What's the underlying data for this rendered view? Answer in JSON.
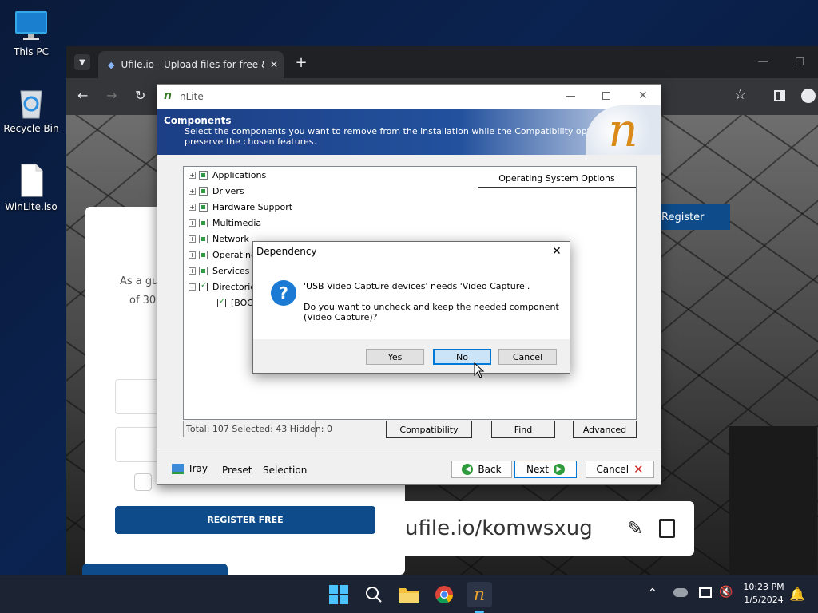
{
  "desktop": {
    "icons": [
      {
        "label": "This PC"
      },
      {
        "label": "Recycle Bin"
      },
      {
        "label": "WinLite.iso"
      }
    ]
  },
  "browser": {
    "tab_title": "Ufile.io - Upload files for free &",
    "tab_close": "✕",
    "new_tab": "+",
    "page": {
      "register_top": "Register",
      "text_line1": "As a gu",
      "text_line2": "of 30",
      "register_free": "REGISTER FREE",
      "link": "ufile.io/komwsxug"
    }
  },
  "nlite": {
    "title": "nLite",
    "header_title": "Components",
    "header_desc1": "Select the components you want to remove from the installation while the Compatibility options",
    "header_desc2": "preserve the chosen features.",
    "tree": [
      {
        "label": "Applications",
        "expander": "+"
      },
      {
        "label": "Drivers",
        "expander": "+"
      },
      {
        "label": "Hardware Support",
        "expander": "+"
      },
      {
        "label": "Multimedia",
        "expander": "+"
      },
      {
        "label": "Network",
        "expander": "+"
      },
      {
        "label": "Operating",
        "expander": "+"
      },
      {
        "label": "Services",
        "expander": "+"
      },
      {
        "label": "Directorie",
        "expander": "-"
      },
      {
        "label": "[BOO"
      }
    ],
    "options_header": "Operating System Options",
    "status": "Total: 107 Selected: 43 Hidden: 0",
    "buttons": {
      "compatibility": "Compatibility",
      "find": "Find",
      "advanced": "Advanced"
    },
    "footer": {
      "tray": "Tray",
      "preset": "Preset",
      "selection": "Selection",
      "back": "Back",
      "next": "Next",
      "cancel": "Cancel"
    }
  },
  "dialog": {
    "title": "Dependency",
    "message1": "'USB Video Capture devices' needs 'Video Capture'.",
    "message2": "Do you want to uncheck and keep the needed component",
    "message3": "(Video Capture)?",
    "yes": "Yes",
    "no": "No",
    "cancel": "Cancel"
  },
  "taskbar": {
    "time": "10:23 PM",
    "date": "1/5/2024"
  }
}
